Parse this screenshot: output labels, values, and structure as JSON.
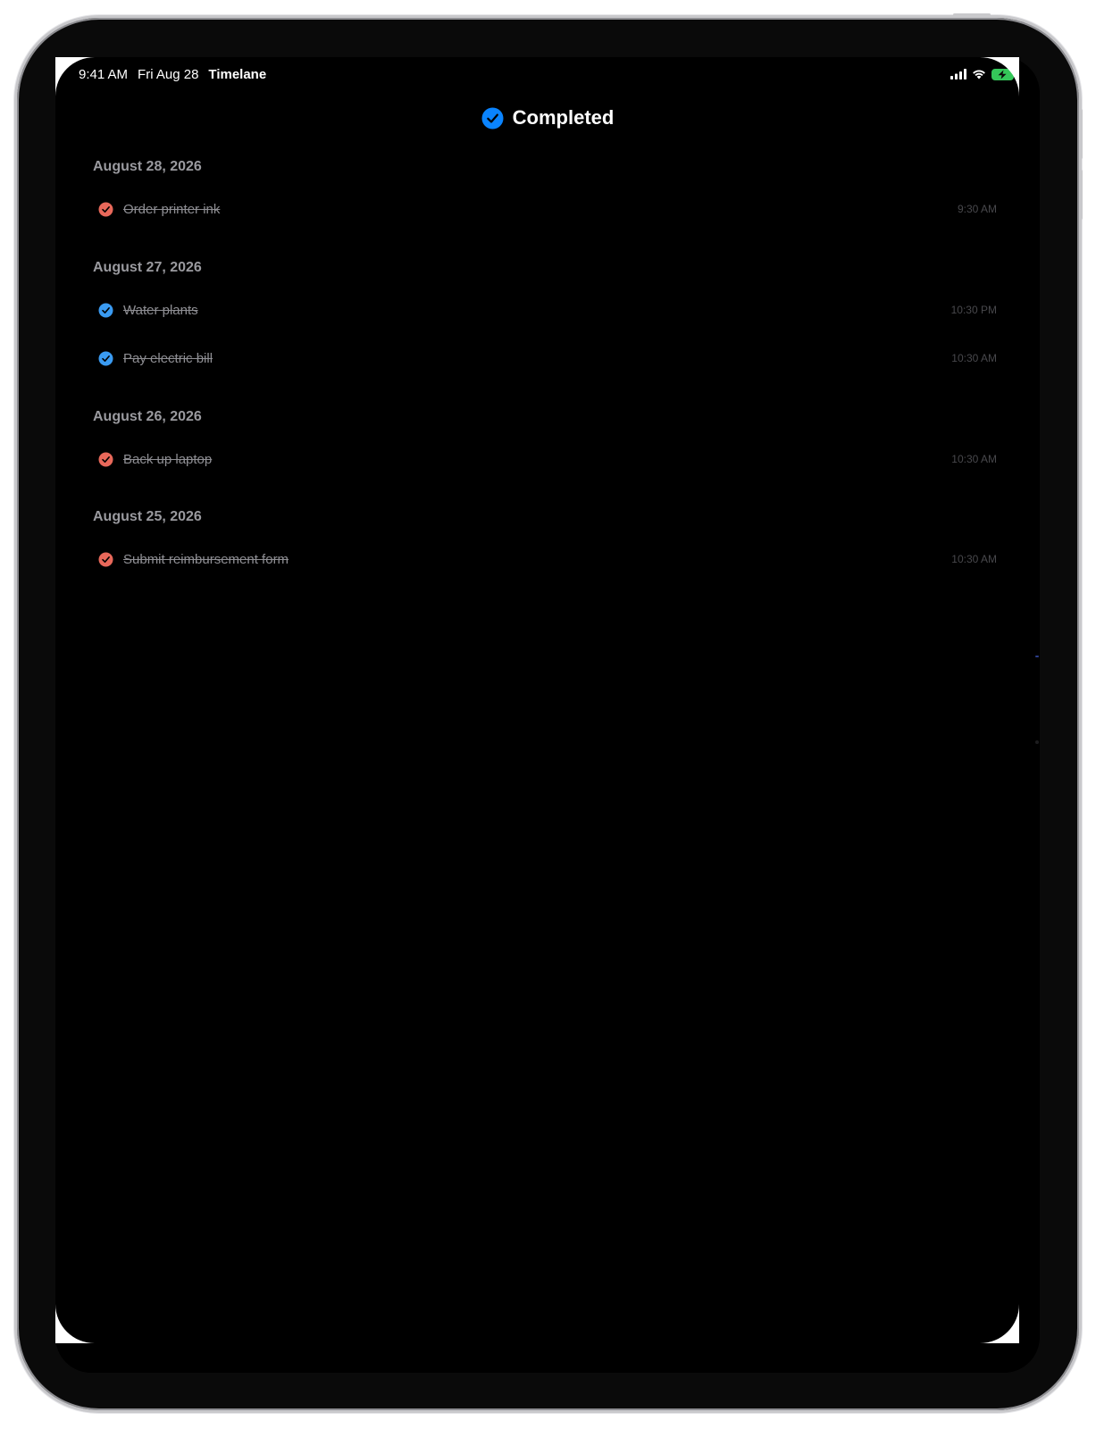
{
  "status_bar": {
    "time": "9:41 AM",
    "date": "Fri Aug 28",
    "app_name": "Timelane",
    "signal_icon": "cellular-signal-icon",
    "wifi_icon": "wifi-icon",
    "battery_icon": "battery-charging-icon"
  },
  "header": {
    "title": "Completed",
    "icon": "checkmark-circle-icon",
    "icon_color": "#0a84ff"
  },
  "colors": {
    "red_check": "#e8685a",
    "blue_check": "#3a9bf2",
    "battery_green": "#34c759"
  },
  "sections": [
    {
      "date": "August 28, 2026",
      "tasks": [
        {
          "title": "Order printer ink",
          "time": "9:30 AM",
          "check_color": "red"
        }
      ]
    },
    {
      "date": "August 27, 2026",
      "tasks": [
        {
          "title": "Water plants",
          "time": "10:30 PM",
          "check_color": "blue"
        },
        {
          "title": "Pay electric bill",
          "time": "10:30 AM",
          "check_color": "blue"
        }
      ]
    },
    {
      "date": "August 26, 2026",
      "tasks": [
        {
          "title": "Back up laptop",
          "time": "10:30 AM",
          "check_color": "red"
        }
      ]
    },
    {
      "date": "August 25, 2026",
      "tasks": [
        {
          "title": "Submit reimbursement form",
          "time": "10:30 AM",
          "check_color": "red"
        }
      ]
    }
  ]
}
